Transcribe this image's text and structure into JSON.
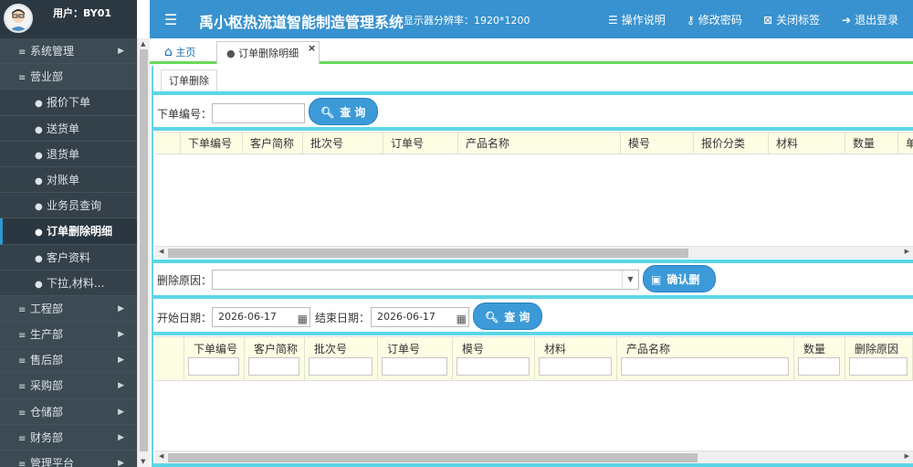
{
  "user": {
    "label": "用户：BY01"
  },
  "sidebar": {
    "items": [
      {
        "label": "系统管理",
        "level": "top",
        "has_arrow": true
      },
      {
        "label": "营业部",
        "level": "top",
        "has_arrow": false
      },
      {
        "label": "报价下单",
        "level": "sub"
      },
      {
        "label": "送货单",
        "level": "sub"
      },
      {
        "label": "退货单",
        "level": "sub"
      },
      {
        "label": "对账单",
        "level": "sub"
      },
      {
        "label": "业务员查询",
        "level": "sub"
      },
      {
        "label": "订单删除明细",
        "level": "sub",
        "active": true
      },
      {
        "label": "客户资料",
        "level": "sub"
      },
      {
        "label": "下拉,材料...",
        "level": "sub"
      },
      {
        "label": "工程部",
        "level": "top",
        "has_arrow": true
      },
      {
        "label": "生产部",
        "level": "top",
        "has_arrow": true
      },
      {
        "label": "售后部",
        "level": "top",
        "has_arrow": true
      },
      {
        "label": "采购部",
        "level": "top",
        "has_arrow": true
      },
      {
        "label": "仓储部",
        "level": "top",
        "has_arrow": true
      },
      {
        "label": "财务部",
        "level": "top",
        "has_arrow": true
      },
      {
        "label": "管理平台",
        "level": "top",
        "has_arrow": true
      }
    ]
  },
  "header": {
    "title": "禹小枢热流道智能制造管理系统",
    "resolution": "显示器分辨率：1920*1200",
    "links": {
      "help": "操作说明",
      "password": "修改密码",
      "close_tabs": "关闭标签",
      "logout": "退出登录"
    }
  },
  "tabs": {
    "home": "主页",
    "current": "订单删除明细"
  },
  "subtab": "订单删除",
  "search1": {
    "label": "下单编号：",
    "value": "",
    "button": "查 询"
  },
  "grid1": {
    "columns": [
      "下单编号",
      "客户简称",
      "批次号",
      "订单号",
      "产品名称",
      "模号",
      "报价分类",
      "材料",
      "数量",
      "单"
    ]
  },
  "delete_form": {
    "reason_label": "删除原因：",
    "reason_value": "",
    "confirm_button": "确认删除"
  },
  "date_search": {
    "start_label": "开始日期：",
    "start_value": "2026-06-17",
    "end_label": "结束日期：",
    "end_value": "2026-06-17",
    "button": "查 询"
  },
  "grid2": {
    "columns": [
      "下单编号",
      "客户简称",
      "批次号",
      "订单号",
      "模号",
      "材料",
      "产品名称",
      "数量",
      "删除原因"
    ]
  },
  "colors": {
    "header_bg": "#3892cf",
    "sidebar_bg": "#3c4a54",
    "accent_cyan": "#5bd6e6",
    "button_bg": "#3c9ad8",
    "tab_underline": "#68d95a"
  }
}
